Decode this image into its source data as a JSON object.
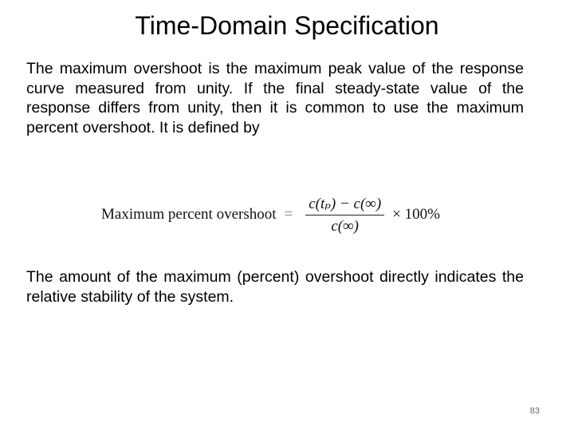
{
  "slide": {
    "title": "Time-Domain Specification",
    "paragraph1": "The maximum overshoot is the maximum peak value of the response curve measured from unity. If the final steady-state value of the response differs from unity, then it is common to use the maximum percent overshoot. It is defined by",
    "formula": {
      "lhs": "Maximum percent overshoot",
      "equals": "=",
      "numerator": "c(tₚ) − c(∞)",
      "denominator": "c(∞)",
      "multiplier": "× 100%"
    },
    "paragraph2": "The amount of the maximum (percent) overshoot directly indicates the relative stability of the system.",
    "page_number": "83"
  }
}
